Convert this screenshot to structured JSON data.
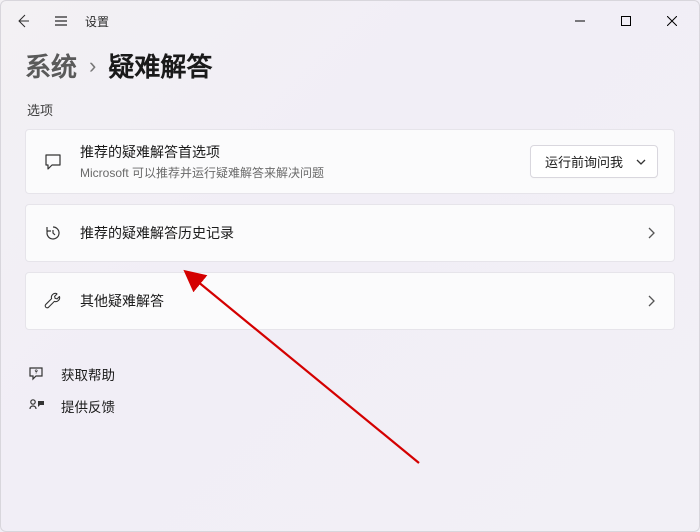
{
  "app_title": "设置",
  "breadcrumb": {
    "parent": "系统",
    "current": "疑难解答"
  },
  "section_label": "选项",
  "cards": {
    "recommended": {
      "title": "推荐的疑难解答首选项",
      "subtitle": "Microsoft 可以推荐并运行疑难解答来解决问题",
      "dropdown_value": "运行前询问我"
    },
    "history": {
      "title": "推荐的疑难解答历史记录"
    },
    "other": {
      "title": "其他疑难解答"
    }
  },
  "links": {
    "help": "获取帮助",
    "feedback": "提供反馈"
  }
}
